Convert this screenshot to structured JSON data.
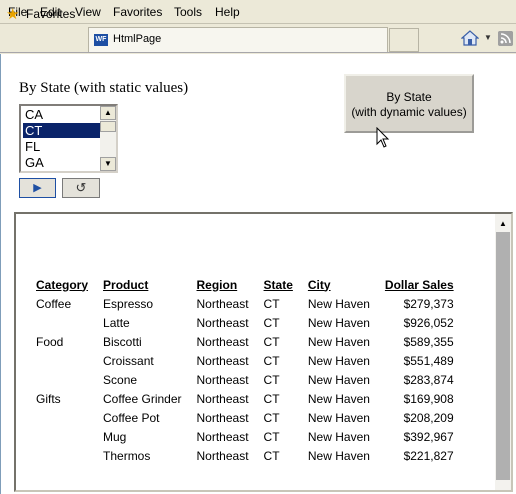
{
  "menu": [
    "File",
    "Edit",
    "View",
    "Favorites",
    "Tools",
    "Help"
  ],
  "favorites_bar": {
    "favorites_label": "Favorites",
    "tab_label": "HtmlPage",
    "tab_icon_text": "WF"
  },
  "static_section": {
    "title": "By State  (with static values)",
    "options": [
      "CA",
      "CT",
      "FL",
      "GA"
    ],
    "selected": "CT",
    "run_icon": "play-icon",
    "reset_icon": "reset-icon"
  },
  "dynamic_button": {
    "line1": "By State",
    "line2": "(with dynamic values)"
  },
  "report": {
    "headers": [
      "Category",
      "Product",
      "Region",
      "State",
      "City",
      "Dollar Sales"
    ],
    "rows": [
      [
        "Coffee",
        "Espresso",
        "Northeast",
        "CT",
        "New Haven",
        "$279,373"
      ],
      [
        "",
        "Latte",
        "Northeast",
        "CT",
        "New Haven",
        "$926,052"
      ],
      [
        "Food",
        "Biscotti",
        "Northeast",
        "CT",
        "New Haven",
        "$589,355"
      ],
      [
        "",
        "Croissant",
        "Northeast",
        "CT",
        "New Haven",
        "$551,489"
      ],
      [
        "",
        "Scone",
        "Northeast",
        "CT",
        "New Haven",
        "$283,874"
      ],
      [
        "Gifts",
        "Coffee Grinder",
        "Northeast",
        "CT",
        "New Haven",
        "$169,908"
      ],
      [
        "",
        "Coffee Pot",
        "Northeast",
        "CT",
        "New Haven",
        "$208,209"
      ],
      [
        "",
        "Mug",
        "Northeast",
        "CT",
        "New Haven",
        "$392,967"
      ],
      [
        "",
        "Thermos",
        "Northeast",
        "CT",
        "New Haven",
        "$221,827"
      ]
    ]
  },
  "colors": {
    "selection": "#0a246a",
    "chrome": "#ece9d8"
  }
}
